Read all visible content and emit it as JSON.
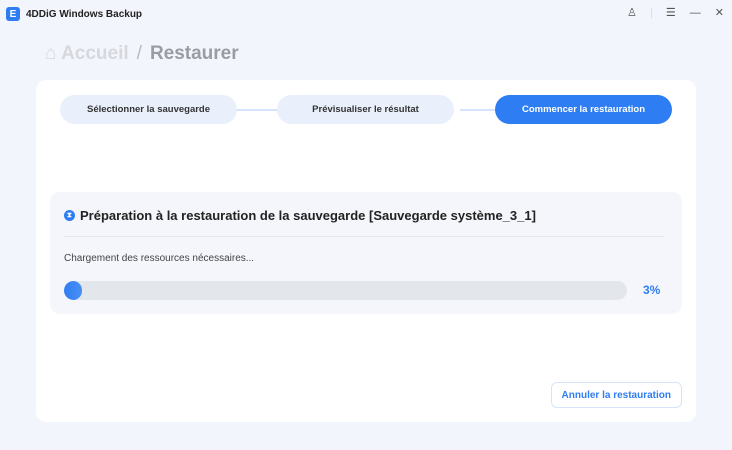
{
  "app": {
    "title": "4DDiG Windows Backup",
    "logo_letter": "E"
  },
  "window_controls": {
    "user": "♙",
    "menu": "☰",
    "minimize": "—",
    "close": "✕"
  },
  "breadcrumb": {
    "home": "Accueil",
    "separator": "/",
    "current": "Restaurer"
  },
  "steps": [
    {
      "label": "Sélectionner la sauvegarde"
    },
    {
      "label": "Prévisualiser le résultat"
    },
    {
      "label": "Commencer la restauration"
    }
  ],
  "progress": {
    "title": "Préparation à la restauration de la sauvegarde [Sauvegarde système_3_1]",
    "status": "Chargement des ressources nécessaires...",
    "percent": 3,
    "percent_label": "3%"
  },
  "cancel_label": "Annuler la restauration",
  "colors": {
    "accent": "#2f7df2"
  }
}
